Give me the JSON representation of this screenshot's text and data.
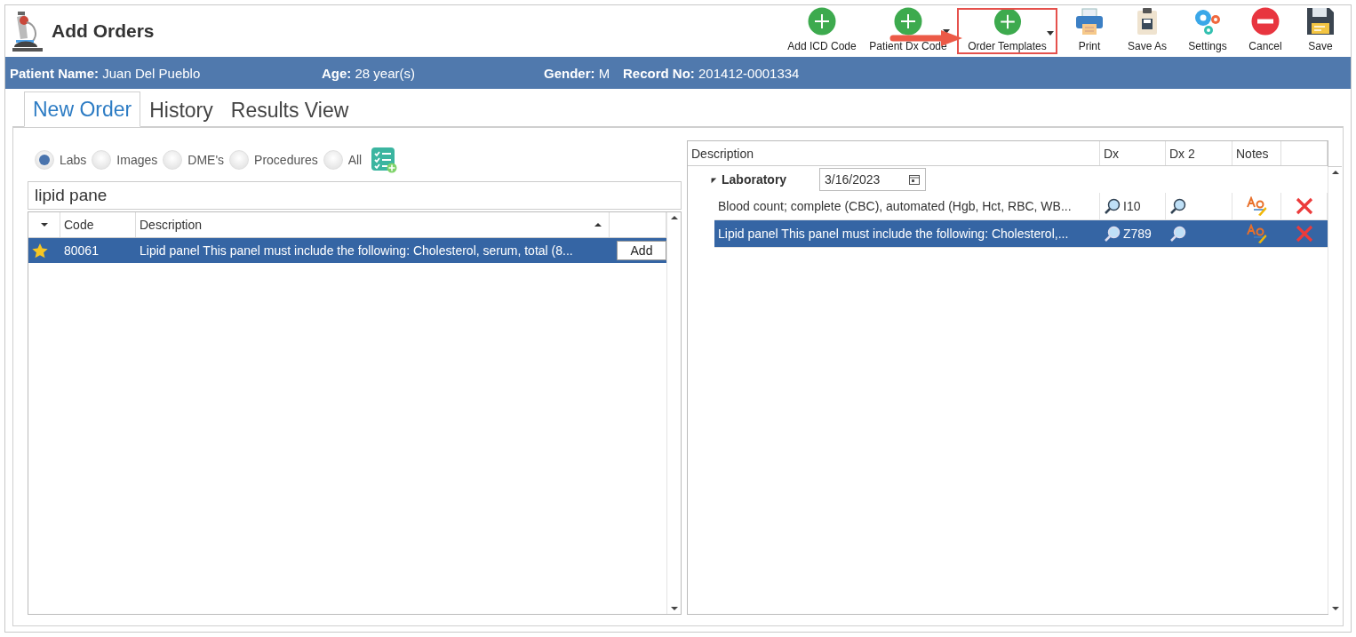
{
  "window": {
    "title": "Add Orders"
  },
  "toolbar": [
    {
      "label": "Add ICD Code",
      "kind": "add",
      "dropdown": false,
      "highlighted": false
    },
    {
      "label": "Patient Dx Code",
      "kind": "add",
      "dropdown": true,
      "highlighted": false
    },
    {
      "label": "Order Templates",
      "kind": "add",
      "dropdown": true,
      "highlighted": true
    },
    {
      "label": "Print",
      "kind": "print",
      "dropdown": false,
      "highlighted": false
    },
    {
      "label": "Save As",
      "kind": "saveas",
      "dropdown": false,
      "highlighted": false
    },
    {
      "label": "Settings",
      "kind": "settings",
      "dropdown": false,
      "highlighted": false
    },
    {
      "label": "Cancel",
      "kind": "cancel",
      "dropdown": false,
      "highlighted": false
    },
    {
      "label": "Save",
      "kind": "save",
      "dropdown": false,
      "highlighted": false
    }
  ],
  "patient": [
    {
      "label": "Patient Name:",
      "value": "Juan Del Pueblo"
    },
    {
      "label": "Age:",
      "value": "28 year(s)"
    },
    {
      "label": "Gender:",
      "value": "M"
    },
    {
      "label": "Record No:",
      "value": "201412-0001334"
    }
  ],
  "tabs": [
    {
      "label": "New Order",
      "selected": true
    },
    {
      "label": "History",
      "selected": false
    },
    {
      "label": "Results View",
      "selected": false
    }
  ],
  "filters": [
    {
      "label": "Labs",
      "selected": true
    },
    {
      "label": "Images",
      "selected": false
    },
    {
      "label": "DME's",
      "selected": false
    },
    {
      "label": "Procedures",
      "selected": false
    },
    {
      "label": "All",
      "selected": false
    }
  ],
  "search": {
    "value": "lipid pane"
  },
  "results": {
    "columns": [
      "Code",
      "Description"
    ],
    "rows": [
      {
        "favorite": true,
        "code": "80061",
        "description": "Lipid panel This panel must include the following: Cholesterol, serum, total (8...",
        "action": "Add",
        "selected": true
      }
    ]
  },
  "orders": {
    "columns": [
      "Description",
      "Dx",
      "Dx 2",
      "Notes"
    ],
    "groups": [
      {
        "name": "Laboratory",
        "expanded": true,
        "date": "3/16/2023",
        "rows": [
          {
            "description": "Blood count; complete (CBC), automated (Hgb, Hct, RBC, WB...",
            "dx": "I10",
            "selected": false
          },
          {
            "description": "Lipid panel This panel must include the following: Cholesterol,...",
            "dx": "Z789",
            "selected": true
          }
        ]
      }
    ]
  }
}
